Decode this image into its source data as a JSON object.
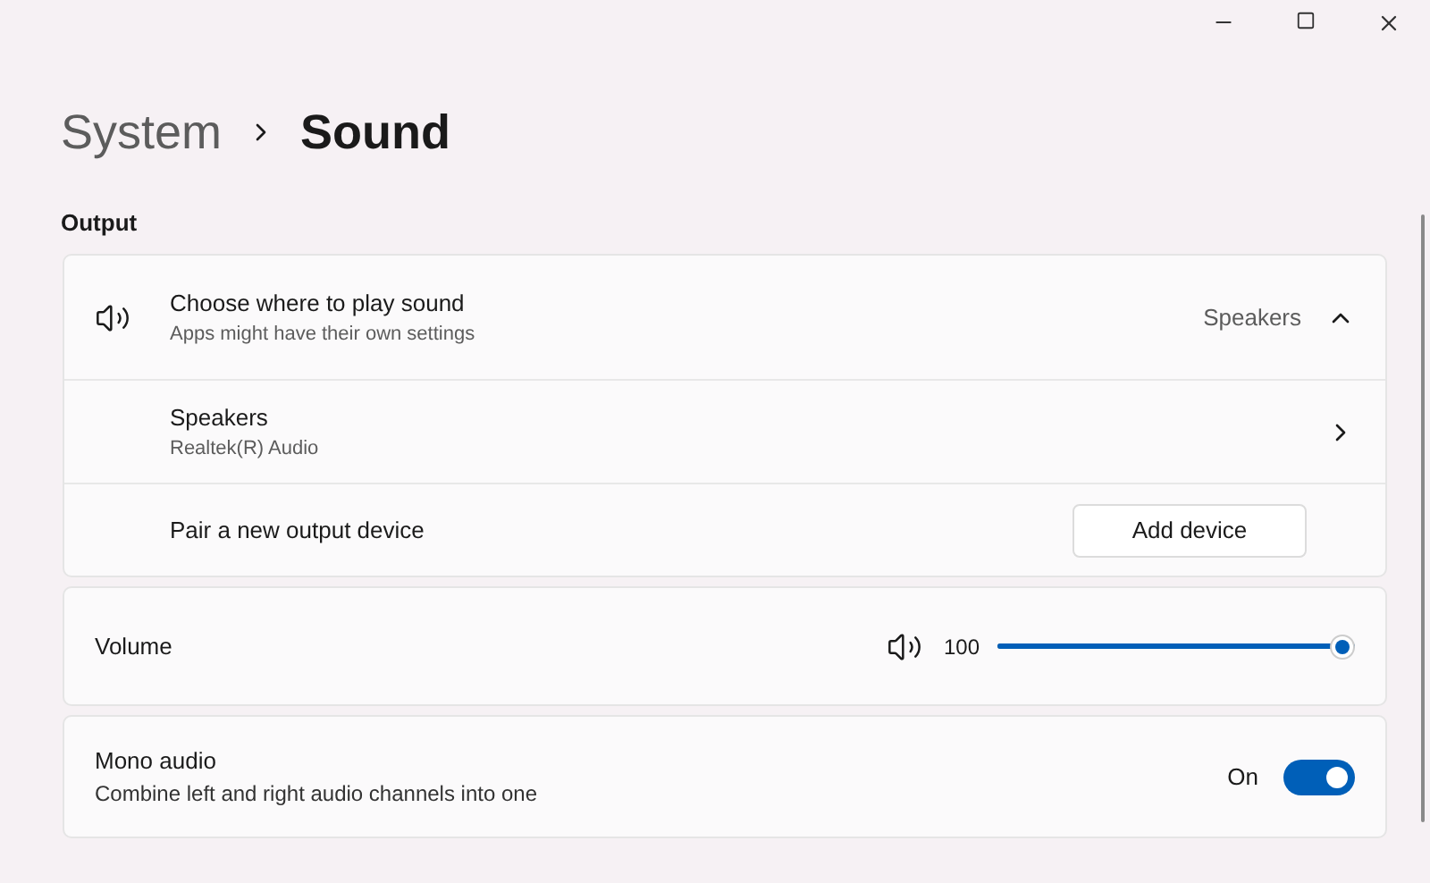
{
  "breadcrumb": {
    "parent": "System",
    "current": "Sound"
  },
  "section_title": "Output",
  "output": {
    "title": "Choose where to play sound",
    "subtitle": "Apps might have their own settings",
    "value": "Speakers",
    "expanded": true,
    "device": {
      "name": "Speakers",
      "subtitle": "Realtek(R) Audio"
    },
    "pair": {
      "label": "Pair a new output device",
      "button": "Add device"
    }
  },
  "volume": {
    "label": "Volume",
    "reading": "100",
    "level": 1.0
  },
  "mono": {
    "title": "Mono audio",
    "subtitle": "Combine left and right audio channels into one",
    "state_label": "On",
    "on": true
  }
}
